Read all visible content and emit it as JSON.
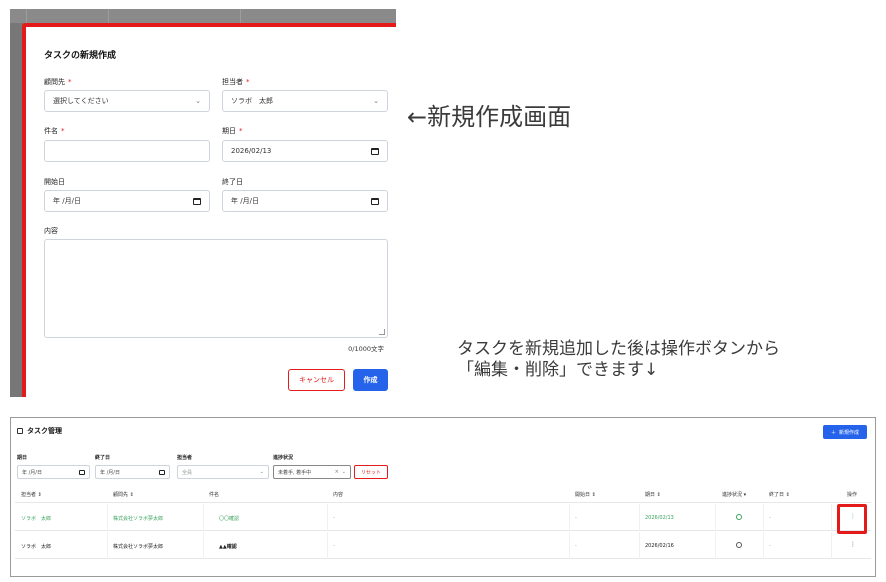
{
  "modal": {
    "title": "タスクの新規作成",
    "fields": {
      "client_label": "顧問先",
      "client_placeholder": "選択してください",
      "assignee_label": "担当者",
      "assignee_value": "ソラボ　太郎",
      "subject_label": "件名",
      "subject_value": "",
      "due_label": "期日",
      "due_value": "2026/02/13",
      "start_label": "開始日",
      "start_value": "年 /月/日",
      "end_label": "終了日",
      "end_value": "年 /月/日",
      "content_label": "内容",
      "counter": "0/1000文字",
      "required_mark": "*"
    },
    "buttons": {
      "cancel": "キャンセル",
      "create": "作成"
    }
  },
  "annotations": {
    "new_screen": "←新規作成画面",
    "note_line1": "タスクを新規追加した後は操作ボタンから",
    "note_line2": "「編集・削除」できます↓"
  },
  "task_list": {
    "title": "タスク管理",
    "new_button": "新規作成",
    "filters": {
      "due_label": "期日",
      "due_value": "年 /月/日",
      "end_label": "終了日",
      "end_value": "年 /月/日",
      "assignee_label": "担当者",
      "assignee_value": "全員",
      "status_label": "進捗状況",
      "status_value": "未着手, 着手中",
      "reset": "リセット"
    },
    "columns": [
      "担当者 ⇕",
      "顧問先 ⇕",
      "件名",
      "内容",
      "開始日 ⇕",
      "期日 ⇕",
      "進捗状況 ▾",
      "終了日 ⇕",
      "操作"
    ],
    "rows": [
      {
        "assignee": "ソラボ　太郎",
        "client": "株式会社ソラボ夢太郎",
        "subject": "〇〇確認",
        "content": "-",
        "start": "-",
        "due": "2026/02/13",
        "end": "-"
      },
      {
        "assignee": "ソラボ　太郎",
        "client": "株式会社ソラボ夢太郎",
        "subject": "▲▲確認",
        "content": "-",
        "start": "-",
        "due": "2026/02/16",
        "end": "-"
      }
    ]
  },
  "colors": {
    "accent": "#2563eb",
    "highlight": "#e31b1b",
    "success": "#3aa35b"
  }
}
